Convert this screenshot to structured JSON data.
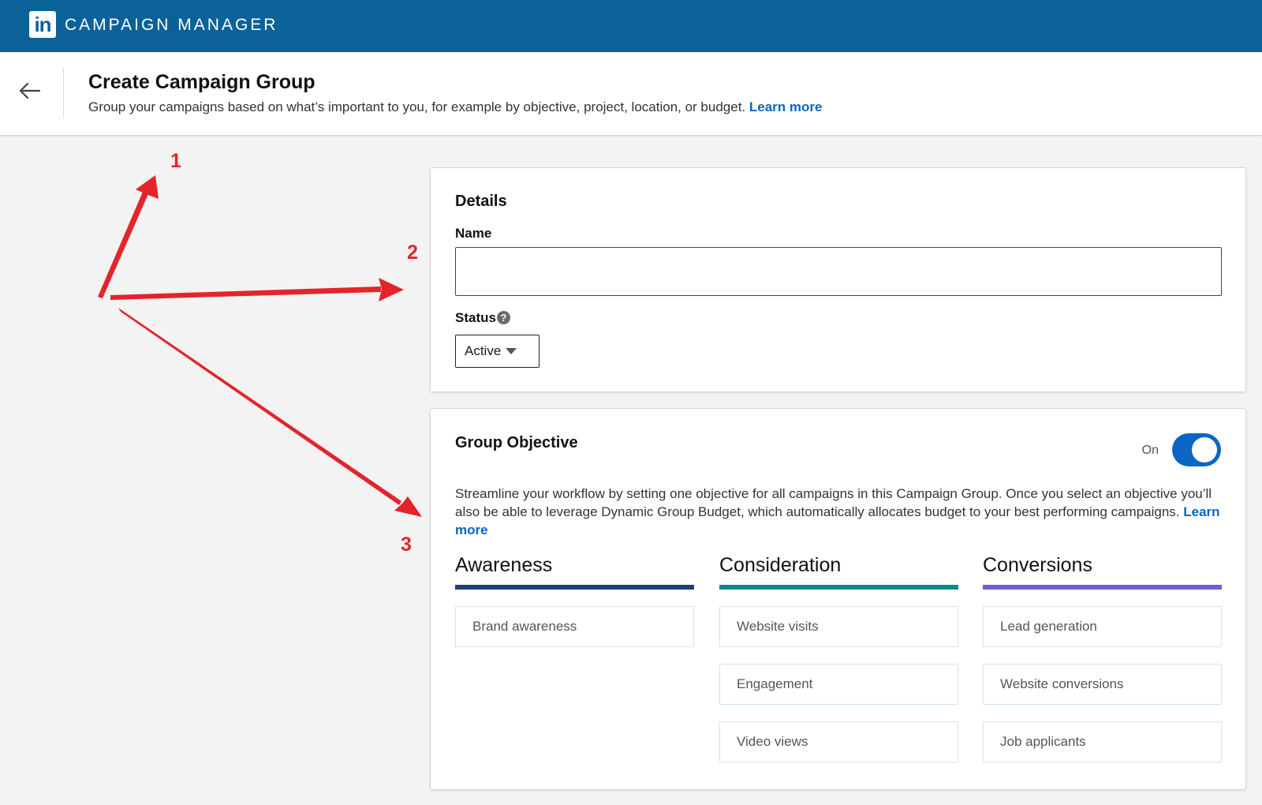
{
  "topbar": {
    "logo_text": "in",
    "app_name": "CAMPAIGN MANAGER"
  },
  "header": {
    "title": "Create Campaign Group",
    "subtitle": "Group your campaigns based on what’s important to you, for example by objective, project, location, or budget.",
    "learn_more": "Learn more"
  },
  "details": {
    "title": "Details",
    "name_label": "Name",
    "name_value": "",
    "status_label": "Status",
    "status_value": "Active"
  },
  "objective": {
    "title": "Group Objective",
    "toggle_label": "On",
    "toggle_on": true,
    "description": "Streamline your workflow by setting one objective for all campaigns in this Campaign Group. Once you select an objective you’ll also be able to leverage Dynamic Group Budget, which automatically allocates budget to your best performing campaigns.",
    "learn_more": "Learn more",
    "columns": [
      {
        "heading": "Awareness",
        "color": "#1d3f72",
        "items": [
          "Brand awareness"
        ]
      },
      {
        "heading": "Consideration",
        "color": "#13868c",
        "items": [
          "Website visits",
          "Engagement",
          "Video views"
        ]
      },
      {
        "heading": "Conversions",
        "color": "#6f5fce",
        "items": [
          "Lead generation",
          "Website conversions",
          "Job applicants"
        ]
      }
    ]
  },
  "annotations": [
    "1",
    "2",
    "3"
  ],
  "colors": {
    "topbar": "#0a6299",
    "link": "#0a66c2",
    "annotation": "#e3242b"
  }
}
